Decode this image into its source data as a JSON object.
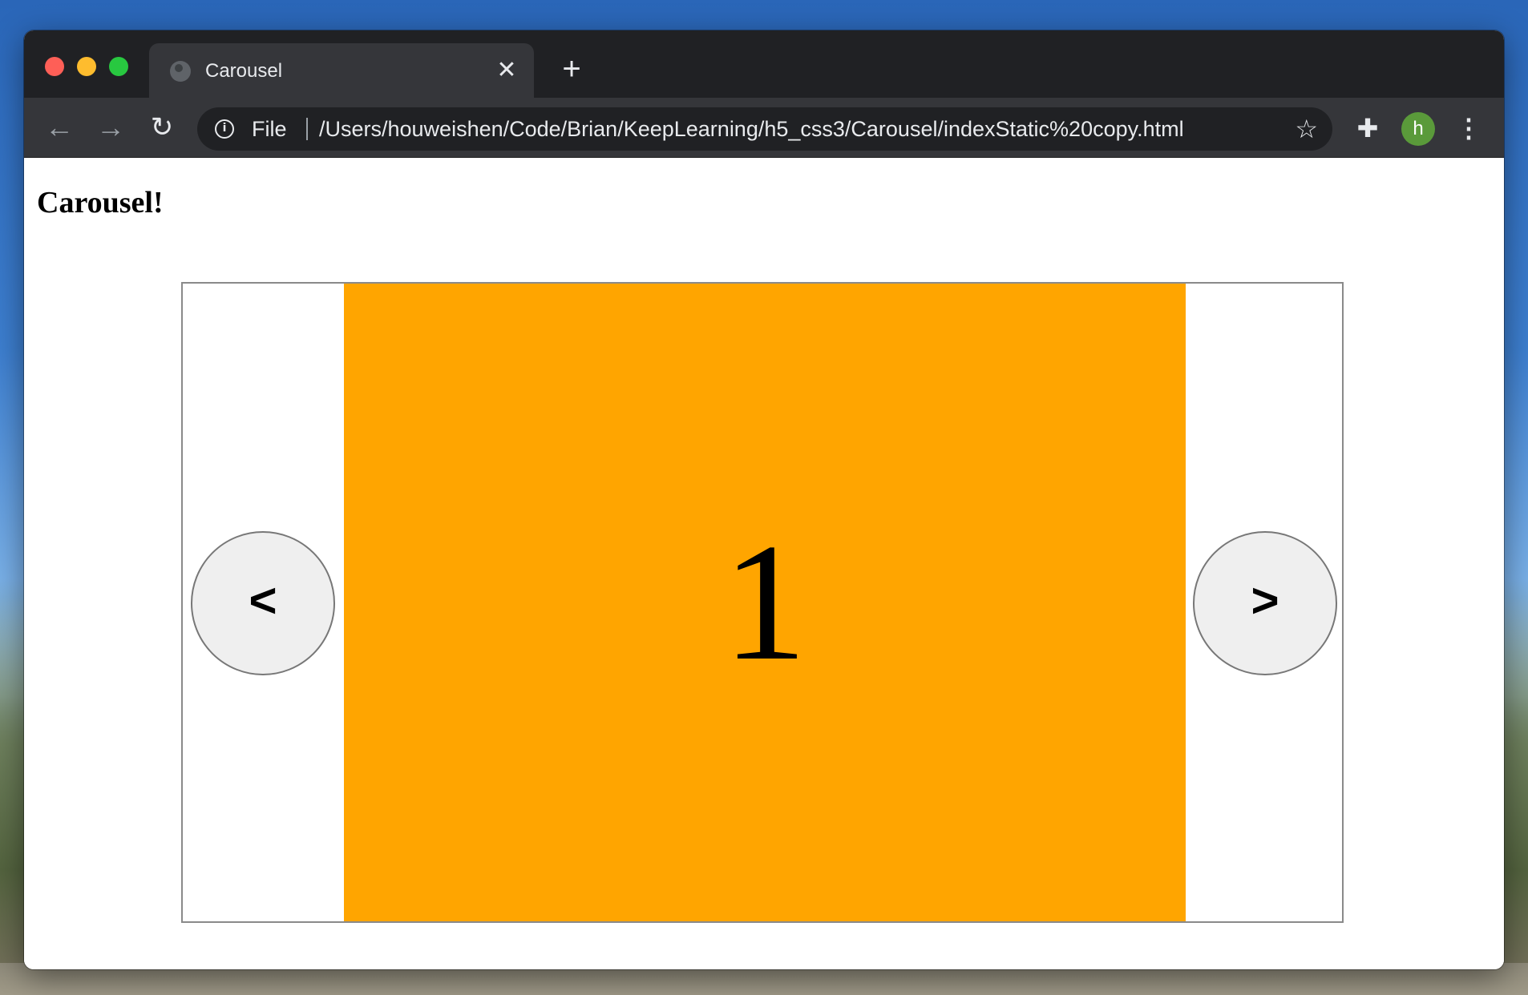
{
  "browser": {
    "tab": {
      "title": "Carousel",
      "favicon": "globe-icon",
      "close_glyph": "✕"
    },
    "new_tab_glyph": "+",
    "toolbar": {
      "back_glyph": "←",
      "forward_glyph": "→",
      "reload_glyph": "↻",
      "scheme_label": "File",
      "info_glyph": "i",
      "url": "/Users/houweishen/Code/Brian/KeepLearning/h5_css3/Carousel/indexStatic%20copy.html",
      "star_glyph": "☆",
      "extensions_glyph": "✚",
      "avatar_letter": "h",
      "avatar_color": "#5a9a3a",
      "menu_glyph": "⋮"
    }
  },
  "page": {
    "heading": "Carousel!",
    "carousel": {
      "slide_number": "1",
      "slide_color": "#ffa500",
      "prev_label": "<",
      "next_label": ">"
    }
  }
}
